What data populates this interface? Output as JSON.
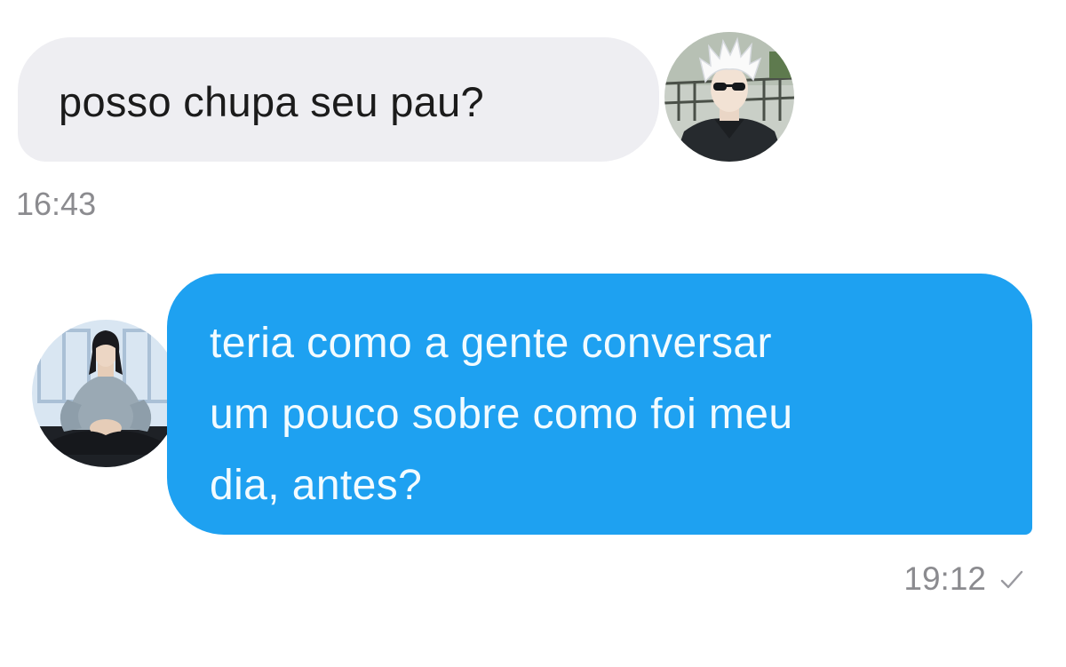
{
  "messages": [
    {
      "direction": "incoming",
      "text": "posso chupa seu pau?",
      "time": "16:43",
      "avatar_icon": "avatar-white-hair-sunglasses"
    },
    {
      "direction": "outgoing",
      "lines": [
        "teria como a gente conversar",
        "um pouco sobre como foi meu",
        "dia, antes?"
      ],
      "time": "19:12",
      "status_icon": "check-icon",
      "avatar_icon": "avatar-long-dark-hair"
    }
  ],
  "colors": {
    "incoming_bubble": "#eeeef2",
    "outgoing_bubble": "#1ea1f1",
    "timestamp": "#8b8b8f"
  }
}
